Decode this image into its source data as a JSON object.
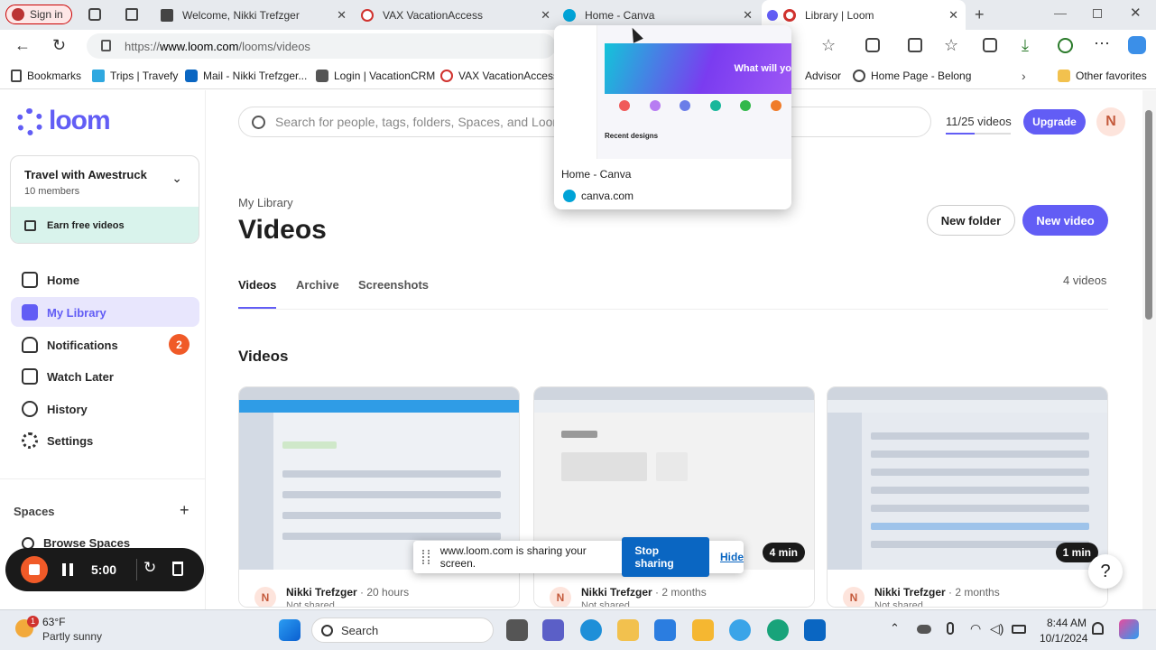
{
  "browser": {
    "signin_label": "Sign in",
    "tabs": [
      {
        "label": "Welcome, Nikki Trefzger",
        "favicon_color": "#444"
      },
      {
        "label": "VAX VacationAccess",
        "favicon_color": "#d0322e"
      },
      {
        "label": "Home - Canva",
        "favicon_color": "#00a3d7"
      },
      {
        "label": "Library | Loom",
        "favicon_color": "#625df5"
      }
    ],
    "url_prefix": "https://",
    "url_host": "www.loom.com",
    "url_path": "/looms/videos",
    "bookmarks": [
      {
        "label": "Bookmarks"
      },
      {
        "label": "Trips | Travefy"
      },
      {
        "label": "Mail - Nikki Trefzger..."
      },
      {
        "label": "Login | VacationCRM"
      },
      {
        "label": "VAX VacationAccess"
      },
      {
        "label": "Advisor"
      },
      {
        "label": "Home Page - Belong"
      },
      {
        "label": "Other favorites"
      }
    ]
  },
  "tab_preview": {
    "title": "Home - Canva",
    "domain": "canva.com",
    "banner_text": "What will yo",
    "recent_label": "Recent designs"
  },
  "sidebar": {
    "brand": "loom",
    "workspace_name": "Travel with Awestruck",
    "workspace_members": "10 members",
    "earn_label": "Earn free videos",
    "items": [
      {
        "label": "Home",
        "icon": "home-icon"
      },
      {
        "label": "My Library",
        "icon": "library-icon"
      },
      {
        "label": "Notifications",
        "icon": "bell-icon",
        "badge": "2"
      },
      {
        "label": "Watch Later",
        "icon": "bookmark-icon"
      },
      {
        "label": "History",
        "icon": "history-icon"
      },
      {
        "label": "Settings",
        "icon": "gear-icon"
      }
    ],
    "spaces_label": "Spaces",
    "browse_spaces": "Browse Spaces"
  },
  "header": {
    "search_placeholder": "Search for people, tags, folders, Spaces, and Looms",
    "usage": "11/25 videos",
    "usage_fraction": 0.44,
    "upgrade_label": "Upgrade",
    "avatar_initial": "N"
  },
  "library": {
    "breadcrumb": "My Library",
    "title": "Videos",
    "new_folder": "New folder",
    "new_video": "New video",
    "tabs": [
      "Videos",
      "Archive",
      "Screenshots"
    ],
    "count": "4 videos",
    "section_title": "Videos"
  },
  "videos": [
    {
      "author": "Nikki Trefzger",
      "age": "20 hours",
      "status": "Not shared",
      "duration": ""
    },
    {
      "author": "Nikki Trefzger",
      "age": "2 months",
      "status": "Not shared",
      "duration": "4 min"
    },
    {
      "author": "Nikki Trefzger",
      "age": "2 months",
      "status": "Not shared",
      "duration": "1 min"
    }
  ],
  "recorder": {
    "time": "5:00"
  },
  "share_bar": {
    "message": "www.loom.com is sharing your screen.",
    "stop_label": "Stop sharing",
    "hide_label": "Hide"
  },
  "taskbar": {
    "temp": "63°F",
    "weather": "Partly sunny",
    "search_label": "Search",
    "time": "8:44 AM",
    "date": "10/1/2024",
    "weather_badge": "1"
  },
  "help_label": "?",
  "colors": {
    "accent": "#625df5",
    "badge": "#f05a28",
    "stop": "#0a66c2"
  }
}
